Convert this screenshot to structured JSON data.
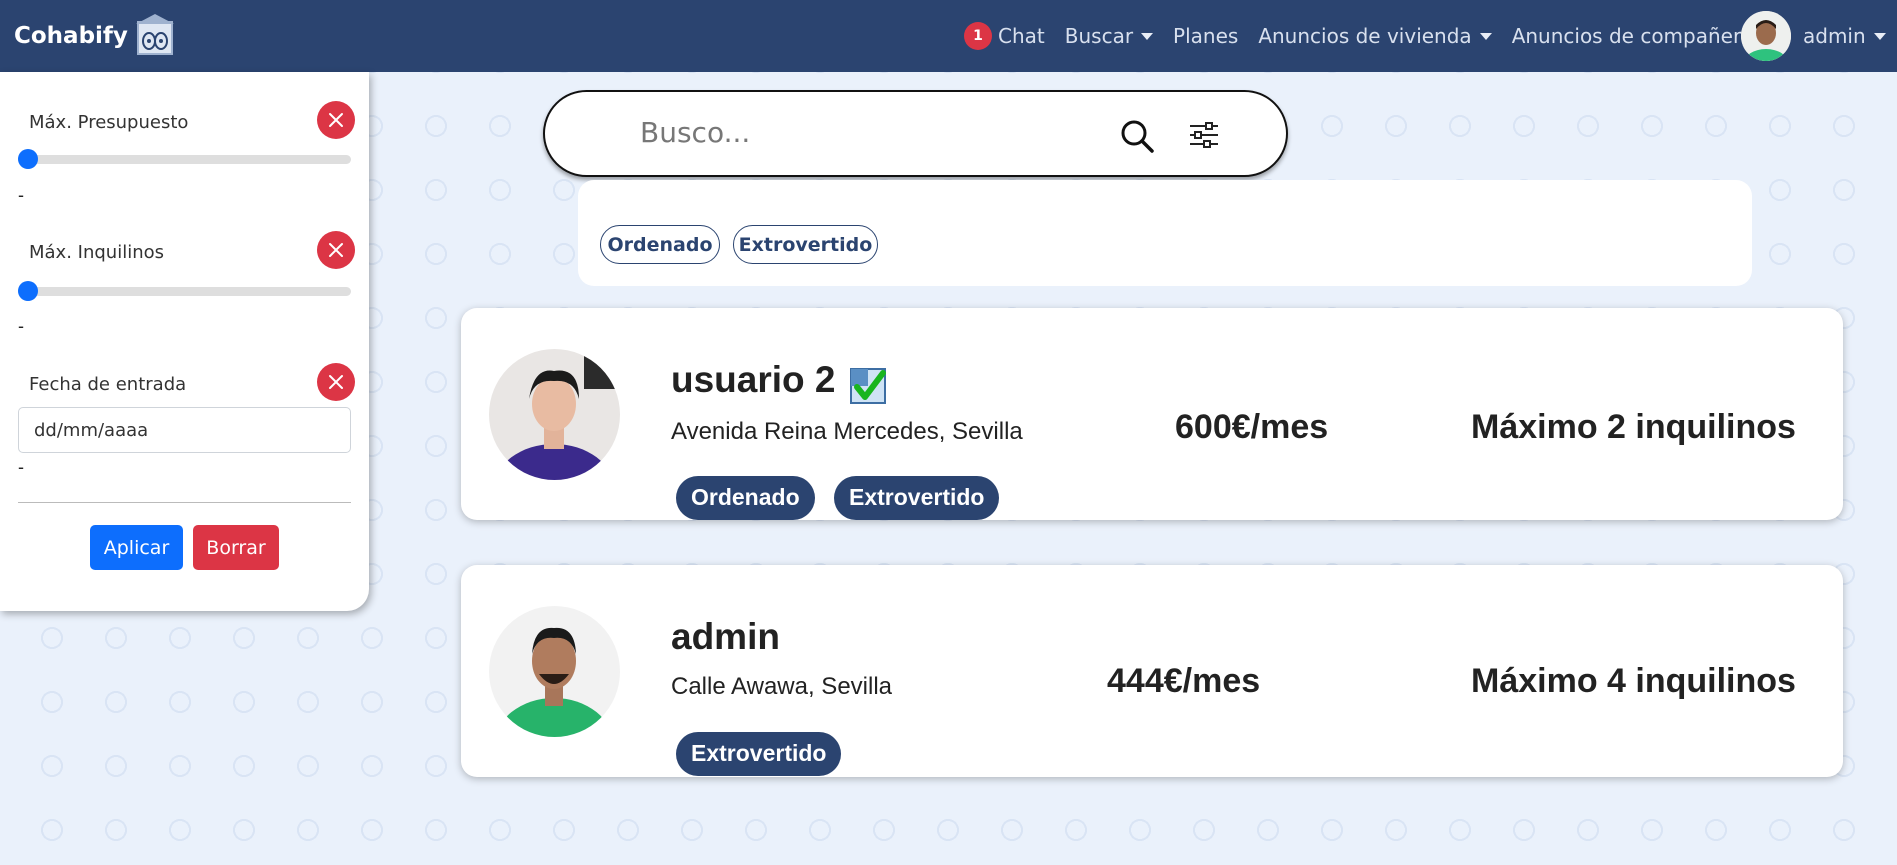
{
  "navbar": {
    "brand": "Cohabify",
    "chat_badge": "1",
    "chat_label": "Chat",
    "search_label": "Buscar",
    "plans_label": "Planes",
    "housing_ads_label": "Anuncios de vivienda",
    "roommate_ads_label": "Anuncios de compañero",
    "user_name": "admin"
  },
  "sidebar": {
    "budget_label": "Máx. Presupuesto",
    "budget_value": "-",
    "budget_level": 0,
    "tenants_label": "Máx. Inquilinos",
    "tenants_value": "-",
    "tenants_level": 0,
    "date_label": "Fecha de entrada",
    "date_placeholder": "dd/mm/aaaa",
    "date_value": "-",
    "apply_label": "Aplicar",
    "clear_label": "Borrar"
  },
  "search": {
    "placeholder": "Busco...",
    "active_tags": [
      "Ordenado",
      "Extrovertido"
    ]
  },
  "results": [
    {
      "name": "usuario 2",
      "verified": true,
      "address": "Avenida Reina Mercedes, Sevilla",
      "price": "600€/mes",
      "max_tenants": "Máximo 2 inquilinos",
      "tags": [
        "Ordenado",
        "Extrovertido"
      ]
    },
    {
      "name": "admin",
      "verified": false,
      "address": "Calle Awawa, Sevilla",
      "price": "444€/mes",
      "max_tenants": "Máximo 4 inquilinos",
      "tags": [
        "Extrovertido"
      ]
    }
  ],
  "icons": {
    "logo": "cohabify-logo-icon",
    "search": "search-icon",
    "filters": "sliders-icon",
    "clear": "close-icon",
    "verified": "verified-check-icon"
  },
  "colors": {
    "navbar": "#2b4470",
    "primary": "#0d6efd",
    "danger": "#dc3545",
    "tag": "#2b4470"
  }
}
